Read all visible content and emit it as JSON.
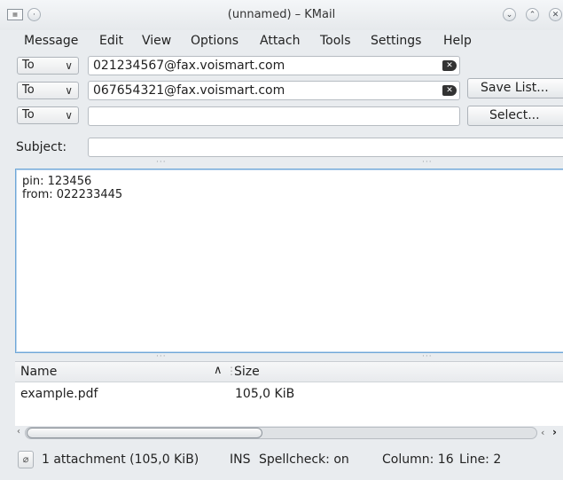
{
  "window": {
    "title": "(unnamed) – KMail",
    "controls": [
      "minimize",
      "maximize",
      "close"
    ]
  },
  "menu": [
    "Message",
    "Edit",
    "View",
    "Options",
    "Attach",
    "Tools",
    "Settings",
    "Help"
  ],
  "recipients": [
    {
      "type": "To",
      "address": "021234567@fax.voismart.com"
    },
    {
      "type": "To",
      "address": "067654321@fax.voismart.com"
    },
    {
      "type": "To",
      "address": ""
    }
  ],
  "buttons": {
    "save_list": "Save List...",
    "select": "Select..."
  },
  "subject": {
    "label": "Subject:",
    "value": ""
  },
  "body": [
    "pin: 123456",
    "from: 022233445"
  ],
  "attachments": {
    "columns": [
      "Name",
      "Size"
    ],
    "rows": [
      {
        "name": "example.pdf",
        "size": "105,0 KiB"
      }
    ]
  },
  "status": {
    "attachment_summary": "1 attachment (105,0 KiB)",
    "mode": "INS",
    "spellcheck": "Spellcheck: on",
    "column": "Column: 16",
    "line": "Line: 2"
  }
}
